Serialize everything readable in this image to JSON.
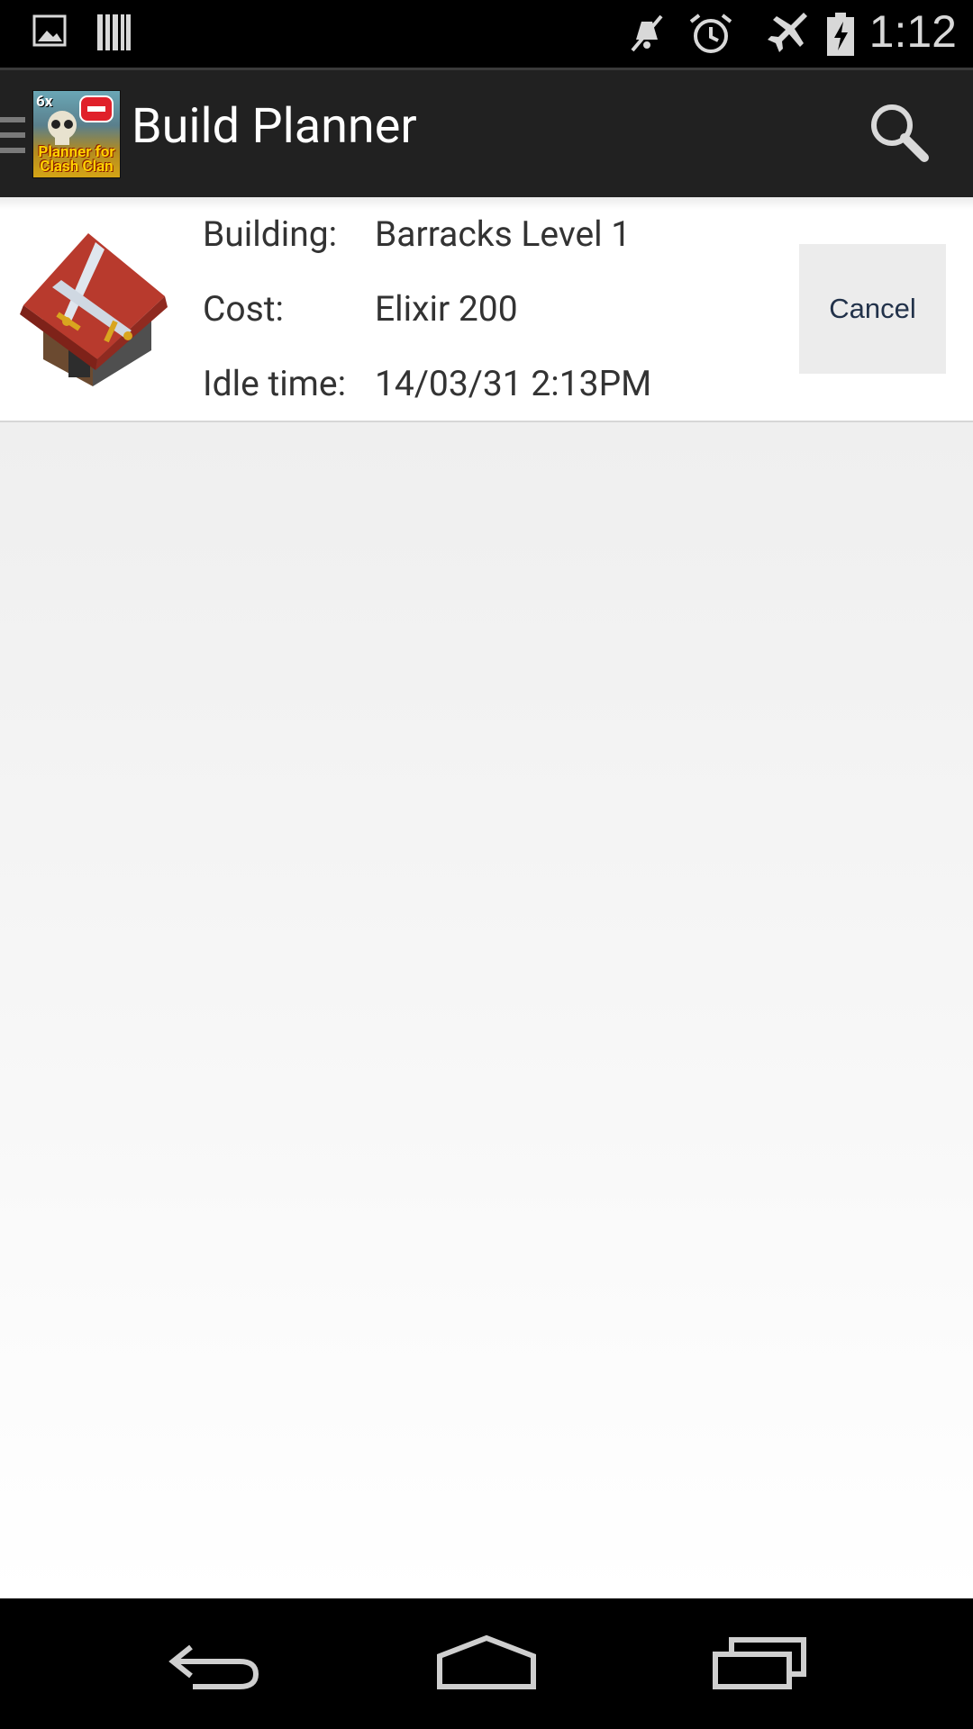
{
  "status_bar": {
    "time": "1:12",
    "icons": [
      "picture-notification-icon",
      "barcode-notification-icon",
      "mute-icon",
      "alarm-icon",
      "airplane-mode-icon",
      "battery-charging-icon"
    ]
  },
  "action_bar": {
    "title": "Build Planner",
    "logo_top": "6x",
    "logo_sub": "Planner for Clash Clan"
  },
  "build_item": {
    "building_label": "Building:",
    "building_value": "Barracks Level 1",
    "cost_label": "Cost:",
    "cost_value": "Elixir 200",
    "idle_label": "Idle time:",
    "idle_value": "14/03/31 2:13PM",
    "cancel_label": "Cancel"
  },
  "nav_bar": {
    "buttons": [
      "back",
      "home",
      "recents"
    ]
  }
}
